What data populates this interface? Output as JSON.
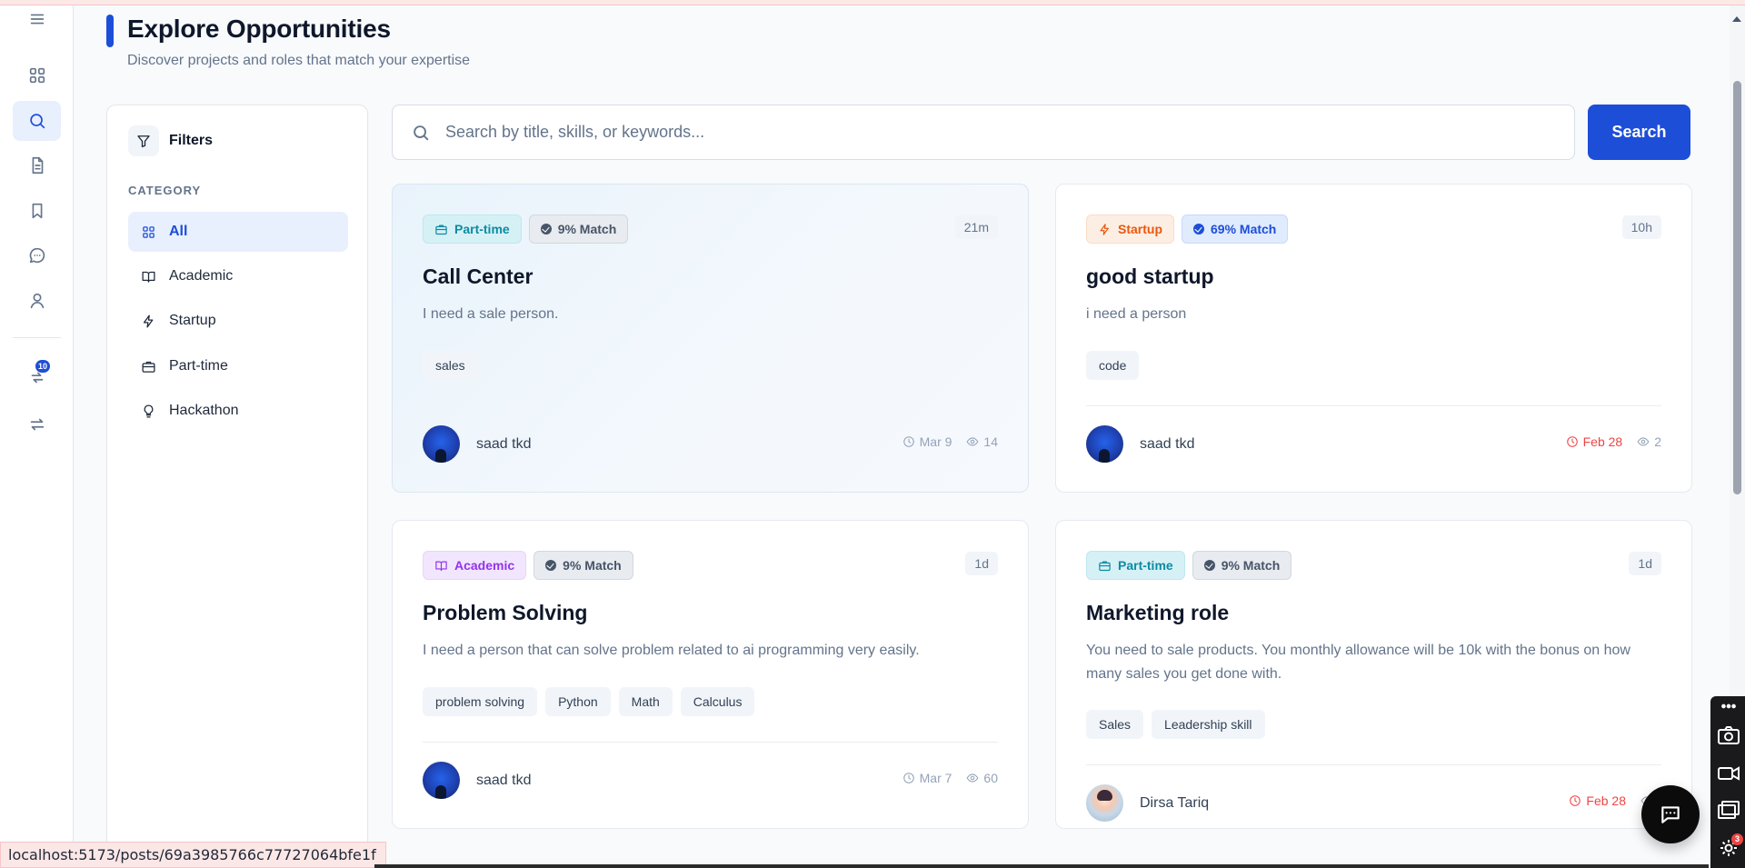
{
  "header": {
    "title": "Explore Opportunities",
    "subtitle": "Discover projects and roles that match your expertise"
  },
  "rail": {
    "notification_count": "10"
  },
  "filters": {
    "title": "Filters",
    "category_label": "CATEGORY",
    "categories": [
      {
        "label": "All",
        "icon": "grid-icon",
        "active": true
      },
      {
        "label": "Academic",
        "icon": "book-icon"
      },
      {
        "label": "Startup",
        "icon": "lightning-icon"
      },
      {
        "label": "Part-time",
        "icon": "briefcase-icon"
      },
      {
        "label": "Hackathon",
        "icon": "lightbulb-icon"
      }
    ]
  },
  "search": {
    "placeholder": "Search by title, skills, or keywords...",
    "value": "",
    "button_label": "Search"
  },
  "colors": {
    "accent": "#1d4ed8",
    "part_time": "#0e8aa3",
    "academic": "#9333ea",
    "startup": "#ea580c",
    "deadline": "#ef4444"
  },
  "posts": [
    {
      "category": "Part-time",
      "match": "9% Match",
      "age": "21m",
      "title": "Call Center",
      "description": "I need a sale person.",
      "tags": [
        "sales"
      ],
      "author": "saad tkd",
      "date": "Mar 9",
      "views": "14"
    },
    {
      "category": "Startup",
      "match": "69% Match",
      "age": "10h",
      "title": "good startup",
      "description": "i need a person",
      "tags": [
        "code"
      ],
      "author": "saad tkd",
      "date": "Feb 28",
      "views": "2"
    },
    {
      "category": "Academic",
      "match": "9% Match",
      "age": "1d",
      "title": "Problem Solving",
      "description": "I need a person that can solve problem related to ai programming very easily.",
      "tags": [
        "problem solving",
        "Python",
        "Math",
        "Calculus"
      ],
      "author": "saad tkd",
      "date": "Mar 7",
      "views": "60"
    },
    {
      "category": "Part-time",
      "match": "9% Match",
      "age": "1d",
      "title": "Marketing role",
      "description": "You need to sale products. You monthly allowance will be 10k with the bonus on how many sales you get done with.",
      "tags": [
        "Sales",
        "Leadership skill"
      ],
      "author": "Dirsa Tariq",
      "date": "Feb 28"
    }
  ],
  "floating": {
    "tools_badge": "3"
  },
  "status_bar": {
    "url": "localhost:5173/posts/69a3985766c77727064bfe1f"
  }
}
